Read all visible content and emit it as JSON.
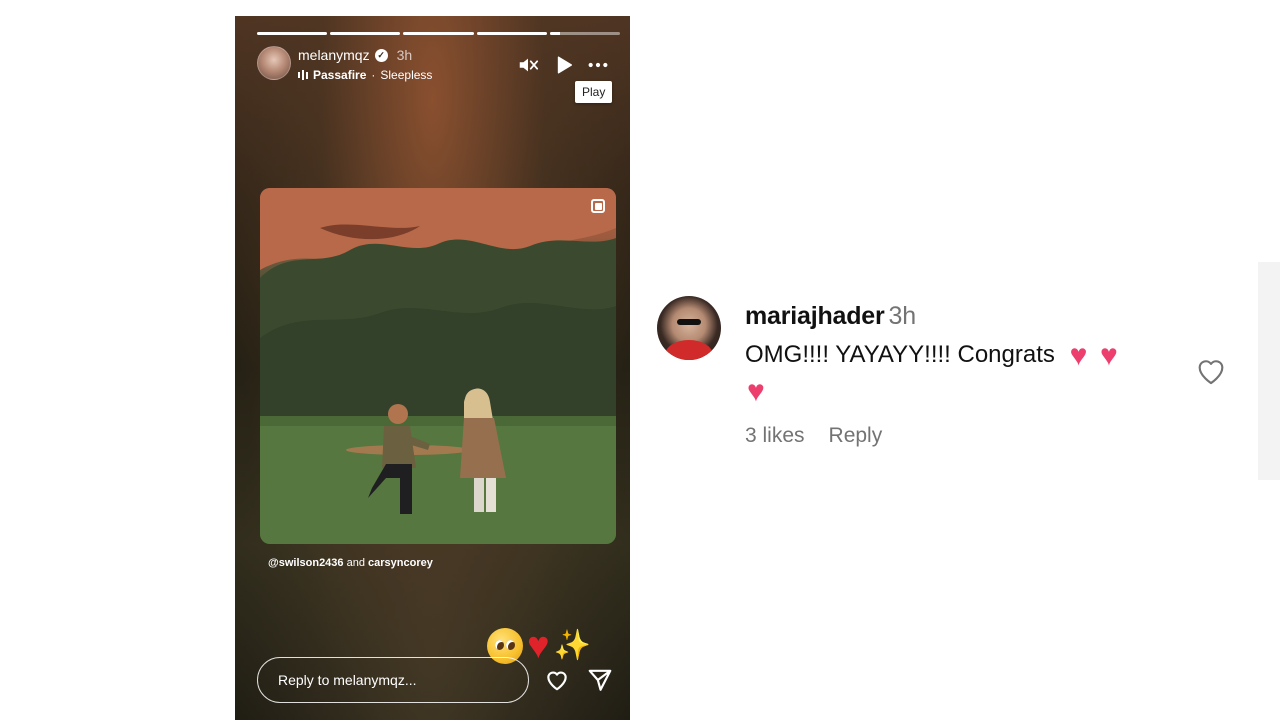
{
  "story": {
    "progress": [
      1,
      1,
      1,
      1,
      0.15
    ],
    "username": "melanymqz",
    "time": "3h",
    "music_artist": "Passafire",
    "music_separator": " · ",
    "music_song": "Sleepless",
    "tooltip": "Play",
    "credit_user": "@swilson2436",
    "credit_and": " and ",
    "credit_user2": "carsyncorey",
    "reply_placeholder": "Reply to melanymqz..."
  },
  "comment": {
    "username": "mariajhader",
    "time": "3h",
    "text": "OMG!!!! YAYAYY!!!! Congrats",
    "likes": "3 likes",
    "reply": "Reply"
  },
  "colors": {
    "heart_pink": "#ec3f6e",
    "heart_red": "#e0232a",
    "meta_gray": "#737373"
  },
  "icons": [
    "mute-icon",
    "play-icon",
    "more-icon",
    "multi-post-icon",
    "heart-icon",
    "send-icon"
  ]
}
